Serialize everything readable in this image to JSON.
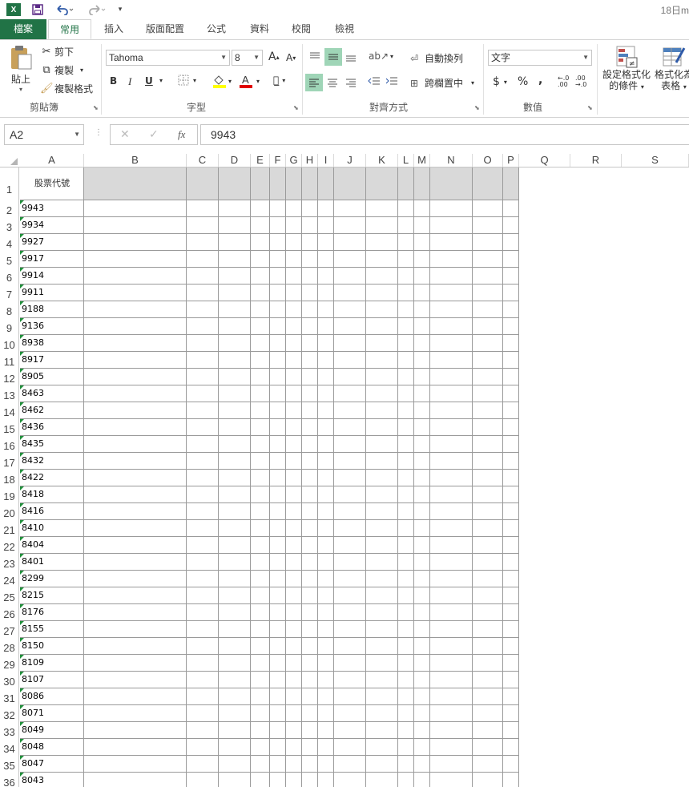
{
  "app": {
    "logo": "X",
    "title": "18日m"
  },
  "quick_access": {
    "save_icon": "save-icon",
    "undo_icon": "undo-icon",
    "redo_icon": "redo-icon"
  },
  "tabs": [
    "檔案",
    "常用",
    "插入",
    "版面配置",
    "公式",
    "資料",
    "校閱",
    "檢視"
  ],
  "ribbon": {
    "clipboard": {
      "paste": "貼上",
      "cut": "剪下",
      "copy": "複製",
      "format_painter": "複製格式",
      "label": "剪貼簿"
    },
    "font": {
      "name": "Tahoma",
      "size": "8",
      "grow": "A",
      "shrink": "A",
      "bold": "B",
      "italic": "I",
      "underline": "U",
      "label": "字型"
    },
    "alignment": {
      "wrap": "自動換列",
      "merge": "跨欄置中",
      "label": "對齊方式"
    },
    "number": {
      "format": "文字",
      "currency": "$",
      "percent": "%",
      "comma": ",",
      "label": "數值"
    },
    "styles": {
      "conditional_line1": "設定格式化",
      "conditional_line2": "的條件",
      "table_line1": "格式化為",
      "table_line2": "表格"
    }
  },
  "formula_bar": {
    "name_box": "A2",
    "fx": "fx",
    "value": "9943"
  },
  "columns": [
    "A",
    "B",
    "C",
    "D",
    "E",
    "F",
    "G",
    "H",
    "I",
    "J",
    "K",
    "L",
    "M",
    "N",
    "O",
    "P",
    "Q",
    "R",
    "S"
  ],
  "header_cell": "股票代號",
  "rows": [
    "1",
    "2",
    "3",
    "4",
    "5",
    "6",
    "7",
    "8",
    "9",
    "10",
    "11",
    "12",
    "13",
    "14",
    "15",
    "16",
    "17",
    "18",
    "19",
    "20",
    "21",
    "22",
    "23",
    "24",
    "25",
    "26",
    "27",
    "28",
    "29",
    "30",
    "31",
    "32",
    "33",
    "34",
    "35",
    "36"
  ],
  "stock_codes": [
    "9943",
    "9934",
    "9927",
    "9917",
    "9914",
    "9911",
    "9188",
    "9136",
    "8938",
    "8917",
    "8905",
    "8463",
    "8462",
    "8436",
    "8435",
    "8432",
    "8422",
    "8418",
    "8416",
    "8410",
    "8404",
    "8401",
    "8299",
    "8215",
    "8176",
    "8155",
    "8150",
    "8109",
    "8107",
    "8086",
    "8071",
    "8049",
    "8048",
    "8047",
    "8043"
  ],
  "colors": {
    "accent": "#217346",
    "header_fill": "#d9d9d9",
    "error_triangle": "#1f8f3a"
  }
}
